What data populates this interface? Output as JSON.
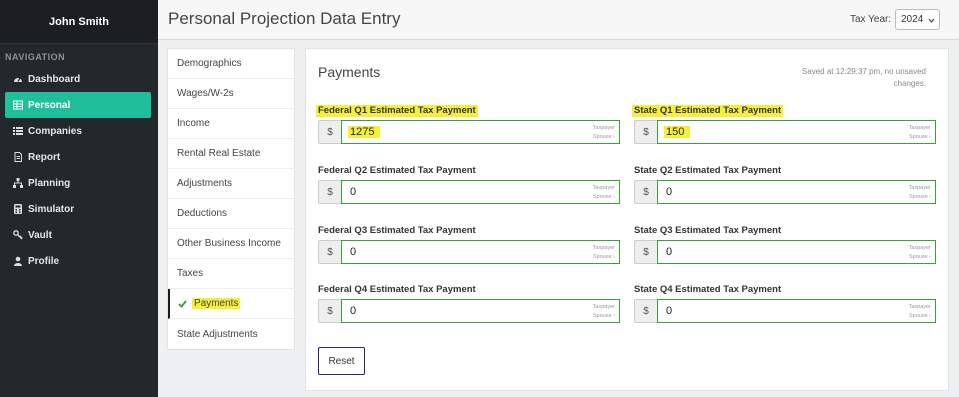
{
  "sidebar": {
    "user_name": "John Smith",
    "nav_heading": "NAVIGATION",
    "items": [
      {
        "label": "Dashboard",
        "icon": "dashboard-icon"
      },
      {
        "label": "Personal",
        "icon": "table-icon",
        "active": true
      },
      {
        "label": "Companies",
        "icon": "list-icon"
      },
      {
        "label": "Report",
        "icon": "document-icon"
      },
      {
        "label": "Planning",
        "icon": "sitemap-icon"
      },
      {
        "label": "Simulator",
        "icon": "calculator-icon"
      },
      {
        "label": "Vault",
        "icon": "key-icon"
      },
      {
        "label": "Profile",
        "icon": "user-icon"
      }
    ]
  },
  "header": {
    "title": "Personal Projection Data Entry",
    "tax_year_label": "Tax Year:",
    "tax_year_value": "2024"
  },
  "subnav": {
    "items": [
      {
        "label": "Demographics"
      },
      {
        "label": "Wages/W-2s"
      },
      {
        "label": "Income"
      },
      {
        "label": "Rental Real Estate"
      },
      {
        "label": "Adjustments"
      },
      {
        "label": "Deductions"
      },
      {
        "label": "Other Business Income"
      },
      {
        "label": "Taxes"
      },
      {
        "label": "Payments",
        "active": true,
        "complete": true
      },
      {
        "label": "State Adjustments"
      }
    ]
  },
  "panel": {
    "title": "Payments",
    "saved_status": "Saved at 12:29:37 pm, no unsaved changes.",
    "currency_symbol": "$",
    "taxpayer_label": "Taxpayer",
    "spouse_label": "Spouse ›",
    "fields": [
      {
        "label": "Federal Q1 Estimated Tax Payment",
        "value": "1275",
        "highlighted": true
      },
      {
        "label": "State Q1 Estimated Tax Payment",
        "value": "150",
        "highlighted": true
      },
      {
        "label": "Federal Q2 Estimated Tax Payment",
        "value": "0"
      },
      {
        "label": "State Q2 Estimated Tax Payment",
        "value": "0"
      },
      {
        "label": "Federal Q3 Estimated Tax Payment",
        "value": "0"
      },
      {
        "label": "State Q3 Estimated Tax Payment",
        "value": "0"
      },
      {
        "label": "Federal Q4 Estimated Tax Payment",
        "value": "0"
      },
      {
        "label": "State Q4 Estimated Tax Payment",
        "value": "0"
      }
    ],
    "reset_label": "Reset"
  },
  "colors": {
    "sidebar_bg": "#23282d",
    "active_nav": "#1fbf9b",
    "input_border": "#3c9e3c",
    "highlight": "#f6ef37",
    "reset_border": "#3b1c6d"
  }
}
